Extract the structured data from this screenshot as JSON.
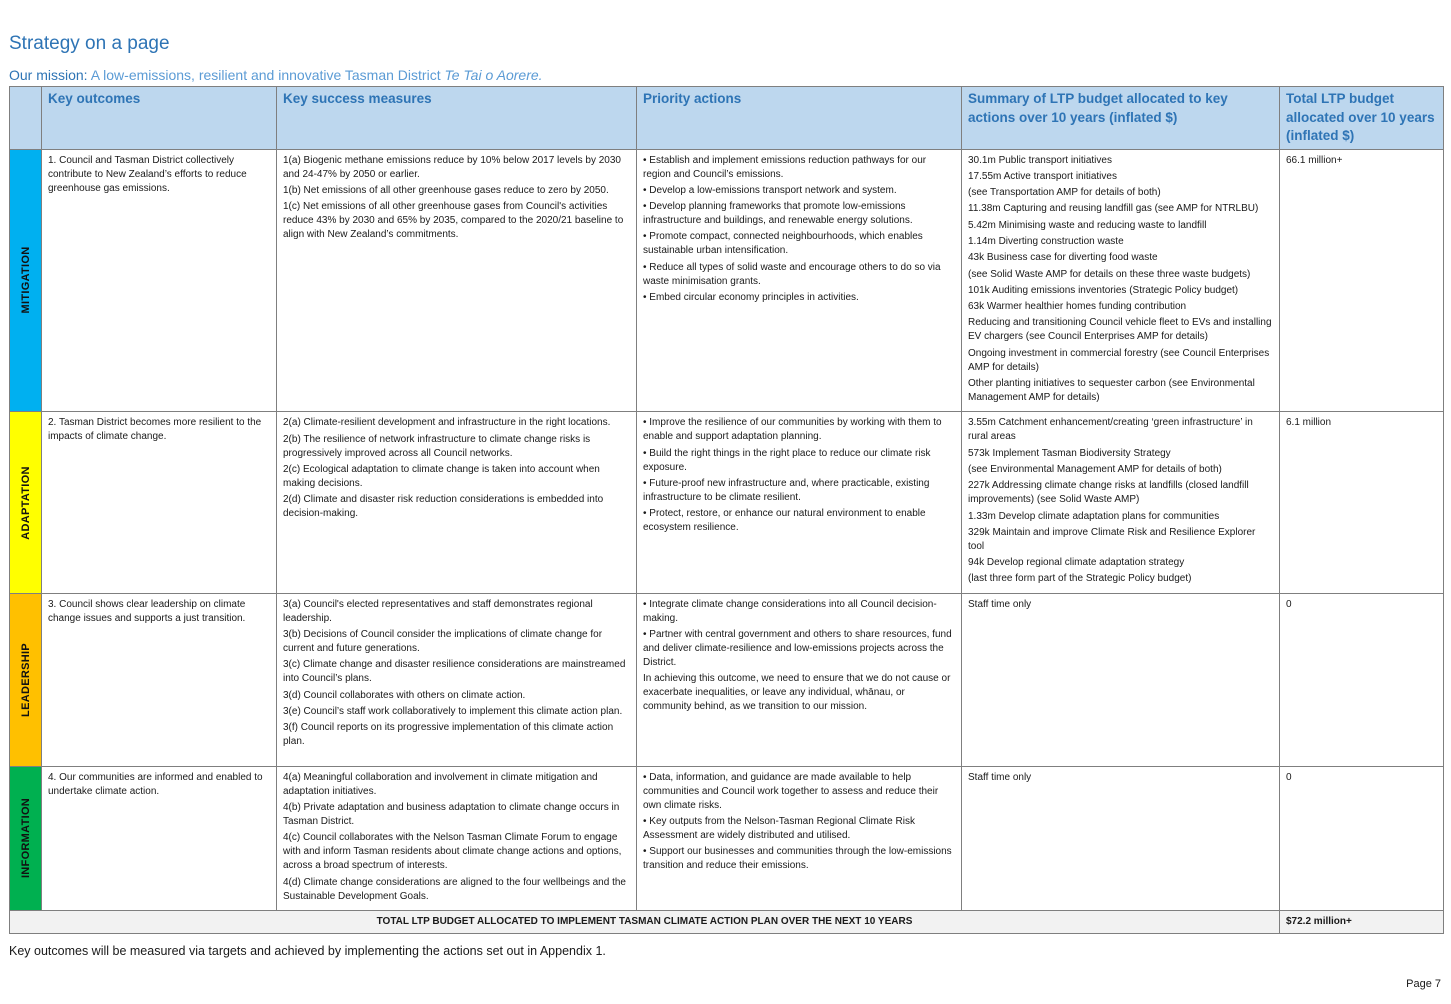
{
  "title": "Strategy on a page",
  "mission": {
    "label": "Our mission:",
    "text": " A low-emissions, resilient and innovative Tasman District ",
    "italic": "Te Tai o Aorere."
  },
  "headers": {
    "outcomes": "Key outcomes",
    "measures": "Key success measures",
    "actions": "Priority actions",
    "summary": "Summary of LTP budget allocated to key actions over 10 years (inflated $)",
    "total": "Total LTP budget allocated over 10 years (inflated $)"
  },
  "rows": [
    {
      "band": "MITIGATION",
      "color": "#00b0f0",
      "outcome": "1. Council and Tasman District collectively contribute to New Zealand’s efforts to reduce greenhouse gas emissions.",
      "measures": [
        "1(a) Biogenic methane emissions reduce by 10% below 2017 levels by 2030 and 24-47% by 2050 or earlier.",
        "1(b) Net emissions of all other greenhouse gases reduce to zero by 2050.",
        "1(c) Net emissions of all other greenhouse gases from Council's activities reduce 43% by 2030 and 65% by 2035, compared to the 2020/21 baseline to align with New Zealand’s commitments."
      ],
      "actions": [
        "• Establish and implement emissions reduction pathways for our region and Council’s emissions.",
        "• Develop a low-emissions transport network and system.",
        "• Develop planning frameworks that promote low-emissions infrastructure and buildings, and renewable energy solutions.",
        "• Promote compact, connected neighbourhoods, which enables sustainable urban intensification.",
        "• Reduce all types of solid waste and encourage others to do so via waste minimisation grants.",
        "• Embed circular economy principles in activities."
      ],
      "summary": [
        "30.1m Public transport initiatives",
        "17.55m Active transport initiatives",
        "(see Transportation AMP for details of both)",
        "11.38m Capturing and reusing landfill gas (see AMP for NTRLBU)",
        "5.42m Minimising waste and reducing waste to landfill",
        "1.14m Diverting construction waste",
        "43k Business case for diverting food waste",
        "(see Solid Waste AMP for details on these three waste budgets)",
        "101k Auditing emissions inventories (Strategic Policy budget)",
        "63k Warmer healthier homes funding contribution",
        "Reducing and transitioning Council vehicle fleet to EVs and installing EV chargers (see Council Enterprises AMP for details)",
        "Ongoing investment in commercial forestry (see Council Enterprises AMP for details)",
        "Other planting initiatives to sequester carbon (see Environmental Management AMP for details)"
      ],
      "total": "66.1 million+"
    },
    {
      "band": "ADAPTATION",
      "color": "#ffff00",
      "outcome": "2. Tasman District becomes more resilient to the impacts of climate change.",
      "measures": [
        "2(a) Climate-resilient development and infrastructure in the right locations.",
        "2(b) The resilience of network infrastructure to climate change risks is progressively improved across all Council networks.",
        "2(c) Ecological adaptation to climate change is taken into account when making decisions.",
        "2(d) Climate and disaster risk reduction considerations is embedded into decision-making."
      ],
      "actions": [
        "• Improve the resilience of our communities by working with them to enable and support adaptation planning.",
        "• Build the right things in the right place to reduce our climate risk exposure.",
        "• Future-proof new infrastructure and, where practicable, existing infrastructure to be climate resilient.",
        "• Protect, restore, or enhance our natural environment to enable ecosystem resilience."
      ],
      "summary": [
        "3.55m Catchment enhancement/creating ‘green infrastructure’ in rural areas",
        "573k Implement Tasman Biodiversity Strategy",
        "(see Environmental Management AMP for details of both)",
        "227k Addressing climate change risks at landfills (closed landfill improvements) (see Solid Waste AMP)",
        "1.33m Develop climate adaptation plans for communities",
        "329k Maintain and improve Climate Risk and Resilience Explorer tool",
        "94k Develop regional climate adaptation strategy",
        "(last three form part of the Strategic Policy budget)"
      ],
      "total": "6.1 million"
    },
    {
      "band": "LEADERSHIP",
      "color": "#ffc000",
      "outcome": "3. Council shows clear leadership on climate change issues and supports a just transition.",
      "measures": [
        "3(a) Council's elected representatives and staff demonstrates regional leadership.",
        "3(b) Decisions of Council consider the implications of climate change for current and future generations.",
        "3(c) Climate change and disaster resilience considerations are mainstreamed into Council’s plans.",
        "3(d) Council collaborates with others on climate action.",
        "3(e) Council’s staff work collaboratively to implement this climate action plan.",
        "3(f) Council reports on its progressive implementation of this climate action plan."
      ],
      "actions": [
        "• Integrate climate change considerations into all Council decision-making.",
        "• Partner with central government and others to share resources, fund and deliver climate-resilience and low-emissions projects across the District.",
        "In achieving this outcome, we need to ensure that we do not cause or exacerbate inequalities, or leave any individual, whānau, or community behind, as we transition to our mission."
      ],
      "summary": [
        "Staff time only"
      ],
      "total": "0"
    },
    {
      "band": "INFORMATION",
      "color": "#00b050",
      "outcome": "4. Our communities are informed and enabled to undertake climate action.",
      "measures": [
        "4(a) Meaningful collaboration and involvement in climate mitigation and adaptation initiatives.",
        "4(b) Private adaptation and business adaptation to climate change occurs in Tasman District.",
        "4(c) Council collaborates with the Nelson Tasman Climate Forum to engage with and inform Tasman residents about climate change actions and options, across a broad spectrum of interests.",
        "4(d) Climate change considerations are aligned to the four wellbeings and the Sustainable Development Goals."
      ],
      "actions": [
        "• Data, information, and guidance are made available to help communities and Council work together to assess and reduce their own climate risks.",
        "• Key outputs from the Nelson-Tasman Regional Climate Risk Assessment are widely distributed and utilised.",
        "• Support our businesses and communities through the low-emissions transition and reduce their emissions."
      ],
      "summary": [
        "Staff time only"
      ],
      "total": "0"
    }
  ],
  "total_row": {
    "label": "TOTAL LTP BUDGET ALLOCATED TO IMPLEMENT TASMAN CLIMATE ACTION PLAN OVER THE NEXT 10 YEARS",
    "value": "$72.2 million+"
  },
  "footnote": "Key outcomes will be measured via targets and achieved by implementing the actions set out in Appendix 1.",
  "page_number": "Page 7"
}
